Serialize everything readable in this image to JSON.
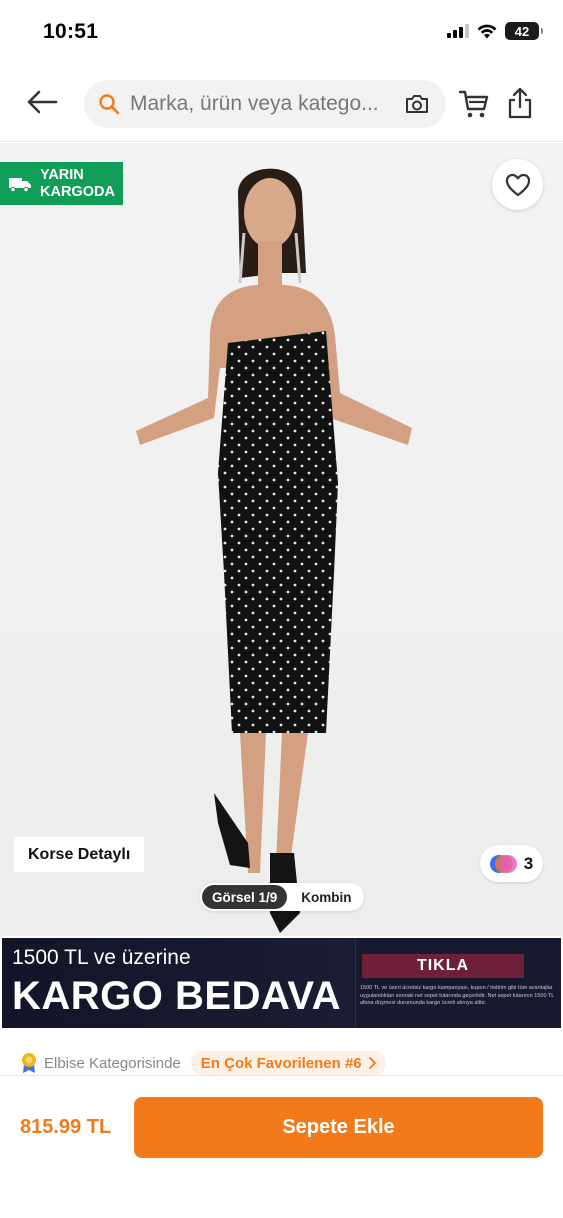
{
  "status_bar": {
    "time": "10:51",
    "battery": "42"
  },
  "header": {
    "search_placeholder": "Marka, ürün veya katego...",
    "icons": [
      "back-arrow-icon",
      "search-icon",
      "camera-icon",
      "cart-icon",
      "share-icon"
    ]
  },
  "product_image": {
    "cargo_badge": {
      "line1": "YARIN",
      "line2": "KARGODA"
    },
    "feature_label": "Korse Detaylı",
    "color_count": "3",
    "gallery_tabs": [
      {
        "label": "Görsel 1/9",
        "active": true
      },
      {
        "label": "Kombin",
        "active": false
      }
    ]
  },
  "promo_banner": {
    "line1": "1500 TL ve üzerine",
    "line2": "KARGO BEDAVA",
    "button": "TIKLA",
    "fine_print": "1500 TL ve üzeri ücretsiz kargo kampanyası, kupon / indirim gibi tüm avantajlar uygulandıktan sonraki net sepet tutarında geçerlidir. Net sepet tutarının 1500 TL altına düşmesi durumunda kargo ücreti alınıya alttır."
  },
  "ranking": {
    "category_text": "Elbise Kategorisinde",
    "rank_label": "En Çok Favorilenen #6"
  },
  "bottom_bar": {
    "price": "815.99 TL",
    "add_to_cart": "Sepete Ekle"
  },
  "colors": {
    "brand_orange": "#f27a1a",
    "cargo_green": "#0f9d58",
    "promo_dark": "#121527",
    "promo_button": "#6e1f3a"
  }
}
